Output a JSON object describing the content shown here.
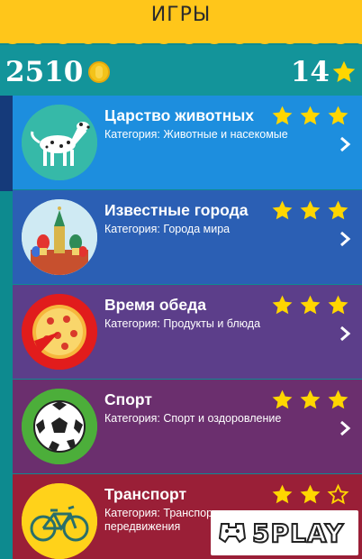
{
  "header": {
    "title": "ИГРЫ"
  },
  "stats": {
    "coins": "2510",
    "stars": "14",
    "coin_icon": "coin-icon",
    "star_icon": "star-icon"
  },
  "colors": {
    "header": "#ffc61a",
    "background": "#0f8a90",
    "star": "#ffd600"
  },
  "categories": [
    {
      "title": "Царство животных",
      "subtitle": "Категория: Животные и насекомые",
      "stars": 3,
      "color": "#1d8ede",
      "icon": "dalmatian-icon"
    },
    {
      "title": "Известные города",
      "subtitle": "Категория: Города мира",
      "stars": 3,
      "color": "#2b5fb4",
      "icon": "kremlin-icon"
    },
    {
      "title": "Время обеда",
      "subtitle": "Категория: Продукты и блюда",
      "stars": 3,
      "color": "#5c3e8a",
      "icon": "pizza-icon"
    },
    {
      "title": "Спорт",
      "subtitle": "Категория: Спорт и оздоровление",
      "stars": 3,
      "color": "#6b2f6e",
      "icon": "soccer-ball-icon"
    },
    {
      "title": "Транспорт",
      "subtitle": "Категория: Транспорт и передвижения",
      "stars": 2,
      "color": "#9a1f37",
      "icon": "bicycle-icon"
    }
  ],
  "watermark": {
    "text": "5PLAY"
  }
}
